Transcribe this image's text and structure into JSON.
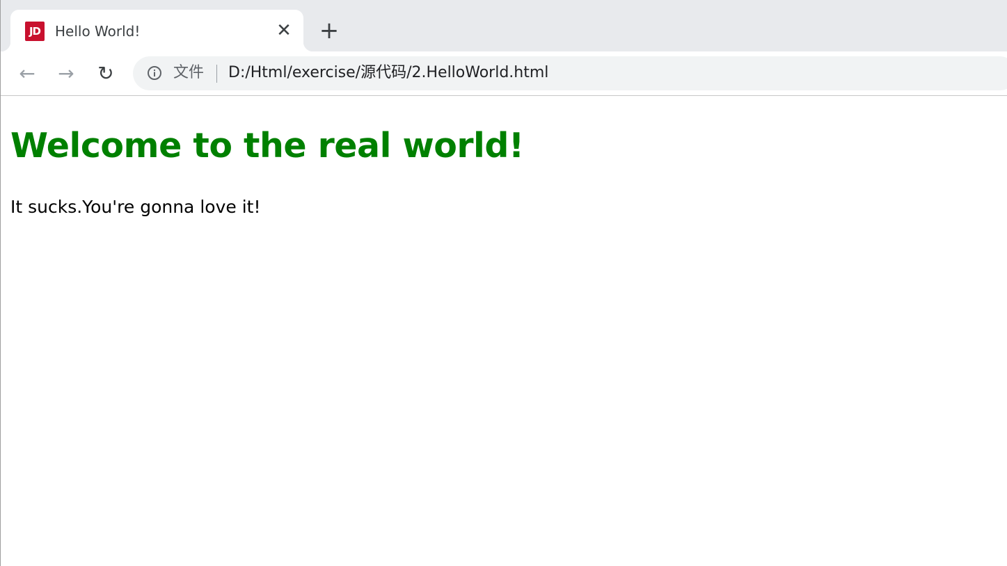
{
  "browser": {
    "tab": {
      "favicon_text": "JD",
      "favicon_color": "#c8102e",
      "title": "Hello World!",
      "close_glyph": "✕"
    },
    "new_tab_glyph": "+",
    "toolbar": {
      "back_glyph": "←",
      "forward_glyph": "→",
      "reload_glyph": "↻"
    },
    "omnibox": {
      "info_icon": "info-icon",
      "chip_label": "文件",
      "url": "D:/Html/exercise/源代码/2.HelloWorld.html"
    }
  },
  "page": {
    "heading": "Welcome to the real world!",
    "heading_color": "#008000",
    "paragraph": "It sucks.You're gonna love it!"
  }
}
